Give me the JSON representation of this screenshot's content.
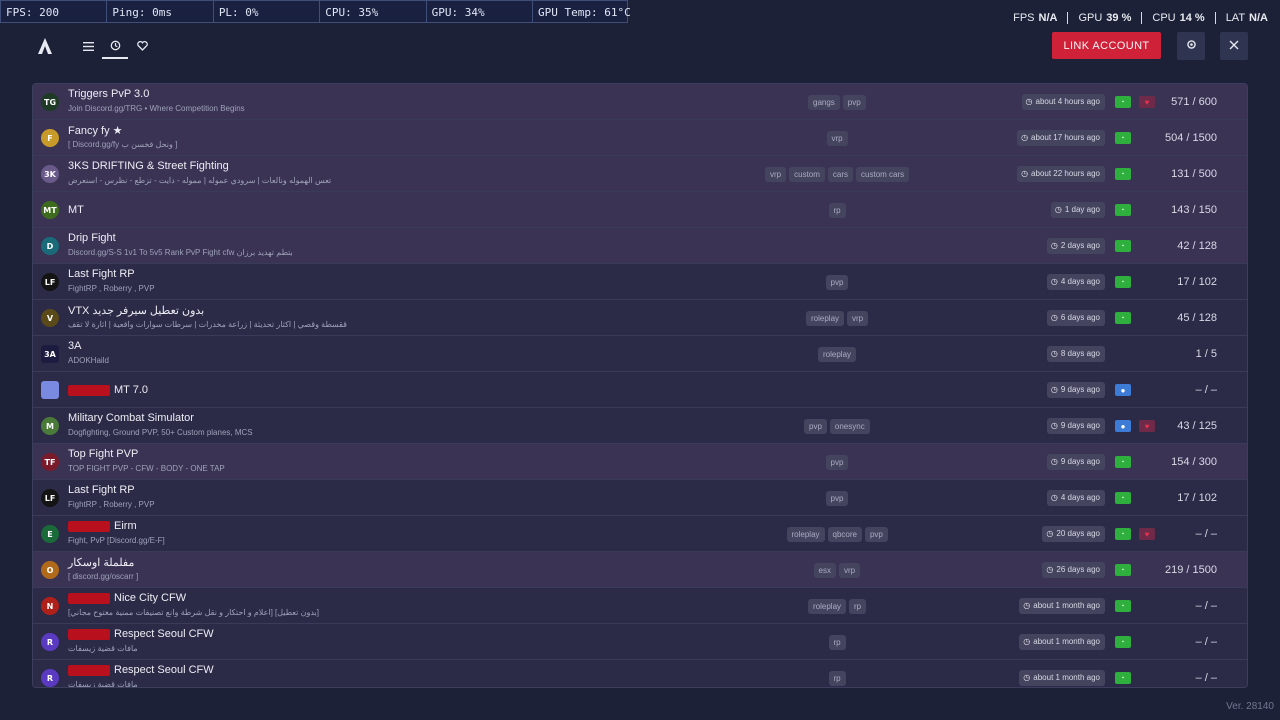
{
  "perf": [
    "FPS: 200",
    "Ping: 0ms",
    "PL: 0%",
    "CPU: 35%",
    "GPU: 34%",
    "GPU Temp: 61°C"
  ],
  "stats": [
    {
      "label": "FPS",
      "value": "N/A"
    },
    {
      "label": "GPU",
      "value": "39 %"
    },
    {
      "label": "CPU",
      "value": "14 %"
    },
    {
      "label": "LAT",
      "value": "N/A"
    }
  ],
  "header": {
    "link_account": "LINK ACCOUNT",
    "icons": {
      "menu": "menu-icon",
      "recent": "recent-icon",
      "favorites": "heart-icon",
      "settings": "gear-icon",
      "close": "close-icon"
    }
  },
  "colors": {
    "accent": "#cf2138",
    "online": "#2fb03e",
    "premium": "#3d7cd6",
    "favorite": "#e3344d"
  },
  "servers": [
    {
      "name": "Triggers PvP 3.0",
      "desc": "Join Discord.gg/TRG • Where Competition Begins",
      "tags": [
        "gangs",
        "pvp"
      ],
      "time": "about 4 hours ago",
      "players": "571 / 600",
      "badge": "green",
      "fav": true,
      "icon": "TG",
      "icon_color": "#1f3a25"
    },
    {
      "name": "Fancy fy ★",
      "desc": "[ Discord.gg/fy ونحل فخسن ب ]",
      "tags": [
        "vrp"
      ],
      "time": "about 17 hours ago",
      "players": "504 / 1500",
      "badge": "green",
      "fav": false,
      "icon": "F",
      "icon_color": "#c79a2a"
    },
    {
      "name": "3KS DRIFTING & Street Fighting",
      "desc": "تعس الهموله ونالعات | سرودي عموله | مموله - دايت - تزطع - نظرس - اسنعرض",
      "tags": [
        "vrp",
        "custom",
        "cars",
        "custom cars"
      ],
      "time": "about 22 hours ago",
      "players": "131 / 500",
      "badge": "green",
      "fav": false,
      "icon": "3K",
      "icon_color": "#6a5a8a"
    },
    {
      "name": "MT",
      "desc": "",
      "tags": [
        "rp"
      ],
      "time": "1 day ago",
      "players": "143 / 150",
      "badge": "green",
      "fav": false,
      "icon": "MT",
      "icon_color": "#3e6b1e"
    },
    {
      "name": "Drip Fight",
      "desc": "Discord.gg/S-S 1v1 To 5v5 Rank PvP Fight cfw بتطم تهديد برزان",
      "tags": [],
      "time": "2 days ago",
      "players": "42 / 128",
      "badge": "green",
      "fav": false,
      "icon": "D",
      "icon_color": "#1a6a7a"
    },
    {
      "name": "Last Fight RP",
      "desc": "FightRP , Roberry , PVP",
      "tags": [
        "pvp"
      ],
      "time": "4 days ago",
      "players": "17 / 102",
      "badge": "green",
      "fav": false,
      "icon": "LF",
      "icon_color": "#141414"
    },
    {
      "name": "VTX بدون تعطيل سيرفر جديد",
      "desc": "ققسطة وقصي | اكثار تحديثة | زراعة مخدرات | سرطات سوارات واقعية | اثارة لا تقف",
      "tags": [
        "roleplay",
        "vrp"
      ],
      "time": "6 days ago",
      "players": "45 / 128",
      "badge": "green",
      "fav": false,
      "icon": "V",
      "icon_color": "#5a4a1a"
    },
    {
      "name": "3A",
      "desc": "ADOKHaild",
      "tags": [
        "roleplay"
      ],
      "time": "8 days ago",
      "players": "1 / 5",
      "badge": "none",
      "fav": false,
      "icon": "3A",
      "icon_color": "#1c1c40"
    },
    {
      "name": "MT 7.0",
      "desc": "",
      "tags": [],
      "time": "9 days ago",
      "players": "– / –",
      "badge": "blue",
      "fav": false,
      "icon": "",
      "icon_color": "#7a8ae0",
      "redtag": true
    },
    {
      "name": "Military Combat Simulator",
      "desc": "Dogfighting, Ground PVP, 50+ Custom planes, MCS",
      "tags": [
        "pvp",
        "onesync"
      ],
      "time": "9 days ago",
      "players": "43 / 125",
      "badge": "blue",
      "fav": true,
      "icon": "M",
      "icon_color": "#4a7a3a"
    },
    {
      "name": "Top Fight PVP",
      "desc": "TOP FIGHT PVP - CFW - BODY - ONE TAP",
      "tags": [
        "pvp"
      ],
      "time": "9 days ago",
      "players": "154 / 300",
      "badge": "green",
      "fav": false,
      "icon": "TF",
      "icon_color": "#7a1a2a"
    },
    {
      "name": "Last Fight RP",
      "desc": "FightRP , Roberry , PVP",
      "tags": [
        "pvp"
      ],
      "time": "4 days ago",
      "players": "17 / 102",
      "badge": "green",
      "fav": false,
      "icon": "LF",
      "icon_color": "#141414"
    },
    {
      "name": "Eirm",
      "desc": "Fight, PvP [Discord.gg/E-F]",
      "tags": [
        "roleplay",
        "qbcore",
        "pvp"
      ],
      "time": "20 days ago",
      "players": "– / –",
      "badge": "green",
      "fav": true,
      "icon": "E",
      "icon_color": "#1a6a3a",
      "redtag": true
    },
    {
      "name": "مفلملة اوسكار",
      "desc": "[ discord.gg/oscarr ]",
      "tags": [
        "esx",
        "vrp"
      ],
      "time": "26 days ago",
      "players": "219 / 1500",
      "badge": "green",
      "fav": false,
      "icon": "O",
      "icon_color": "#b06a1a"
    },
    {
      "name": "Nice City CFW",
      "desc": "[اعلام و احتكار و نقل شرطة وانع تصنيفات ممنية مغتوح مجاني] [بدون تعطيل]",
      "tags": [
        "roleplay",
        "rp"
      ],
      "time": "about 1 month ago",
      "players": "– / –",
      "badge": "green",
      "fav": false,
      "icon": "N",
      "icon_color": "#b0201a",
      "redtag": true
    },
    {
      "name": "Respect Seoul CFW",
      "desc": "مافات قضية زيسفات",
      "tags": [
        "rp"
      ],
      "time": "about 1 month ago",
      "players": "– / –",
      "badge": "green",
      "fav": false,
      "icon": "R",
      "icon_color": "#5a3ac0",
      "redtag": true
    },
    {
      "name": "Respect Seoul CFW",
      "desc": "مافات قضية زيسفات",
      "tags": [
        "rp"
      ],
      "time": "about 1 month ago",
      "players": "– / –",
      "badge": "green",
      "fav": false,
      "icon": "R",
      "icon_color": "#5a3ac0",
      "redtag": true
    }
  ],
  "version": "Ver. 28140"
}
